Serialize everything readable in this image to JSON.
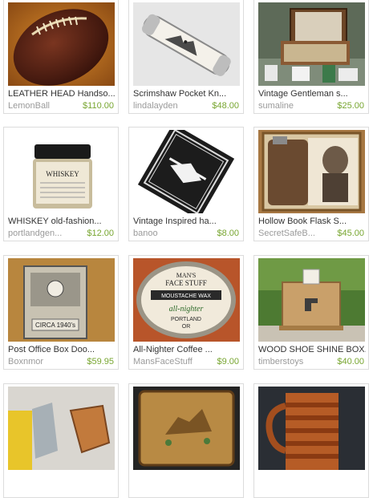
{
  "items": [
    {
      "title": "LEATHER HEAD Handso...",
      "shop": "LemonBall",
      "price": "$110.00",
      "icon": "leather-football"
    },
    {
      "title": "Scrimshaw Pocket Kn...",
      "shop": "lindalayden",
      "price": "$48.00",
      "icon": "pocket-knife"
    },
    {
      "title": "Vintage Gentleman s...",
      "shop": "sumaline",
      "price": "$25.00",
      "icon": "grooming-kit"
    },
    {
      "title": "WHISKEY old-fashion...",
      "shop": "portlandgen...",
      "price": "$12.00",
      "icon": "whiskey-jar",
      "jar_label": "WHISKEY"
    },
    {
      "title": "Vintage Inspired ha...",
      "shop": "banoo",
      "price": "$8.00",
      "icon": "handkerchief"
    },
    {
      "title": "Hollow Book Flask S...",
      "shop": "SecretSafeB...",
      "price": "$45.00",
      "icon": "book-flask"
    },
    {
      "title": "Post Office Box Doo...",
      "shop": "Boxnmor",
      "price": "$59.95",
      "icon": "po-box-door",
      "plate_text": "CIRCA 1940's"
    },
    {
      "title": "All-Nighter Coffee ...",
      "shop": "MansFaceStuff",
      "price": "$9.00",
      "icon": "moustache-wax",
      "tin_lines": [
        "MAN'S",
        "FACE STUFF",
        "MOUSTACHE WAX",
        "all-nighter",
        "PORTLAND",
        "OR"
      ]
    },
    {
      "title": "WOOD SHOE SHINE BOX...",
      "shop": "timberstoys",
      "price": "$40.00",
      "icon": "shoe-shine-box"
    },
    {
      "title": "",
      "shop": "",
      "price": "",
      "icon": "axe-sheath"
    },
    {
      "title": "",
      "shop": "",
      "price": "",
      "icon": "tooled-wallet"
    },
    {
      "title": "",
      "shop": "",
      "price": "",
      "icon": "wood-mug"
    }
  ],
  "colors": {
    "price": "#78a631",
    "shop": "#9a9a9a",
    "title": "#333333",
    "border": "#dcdcdc"
  }
}
